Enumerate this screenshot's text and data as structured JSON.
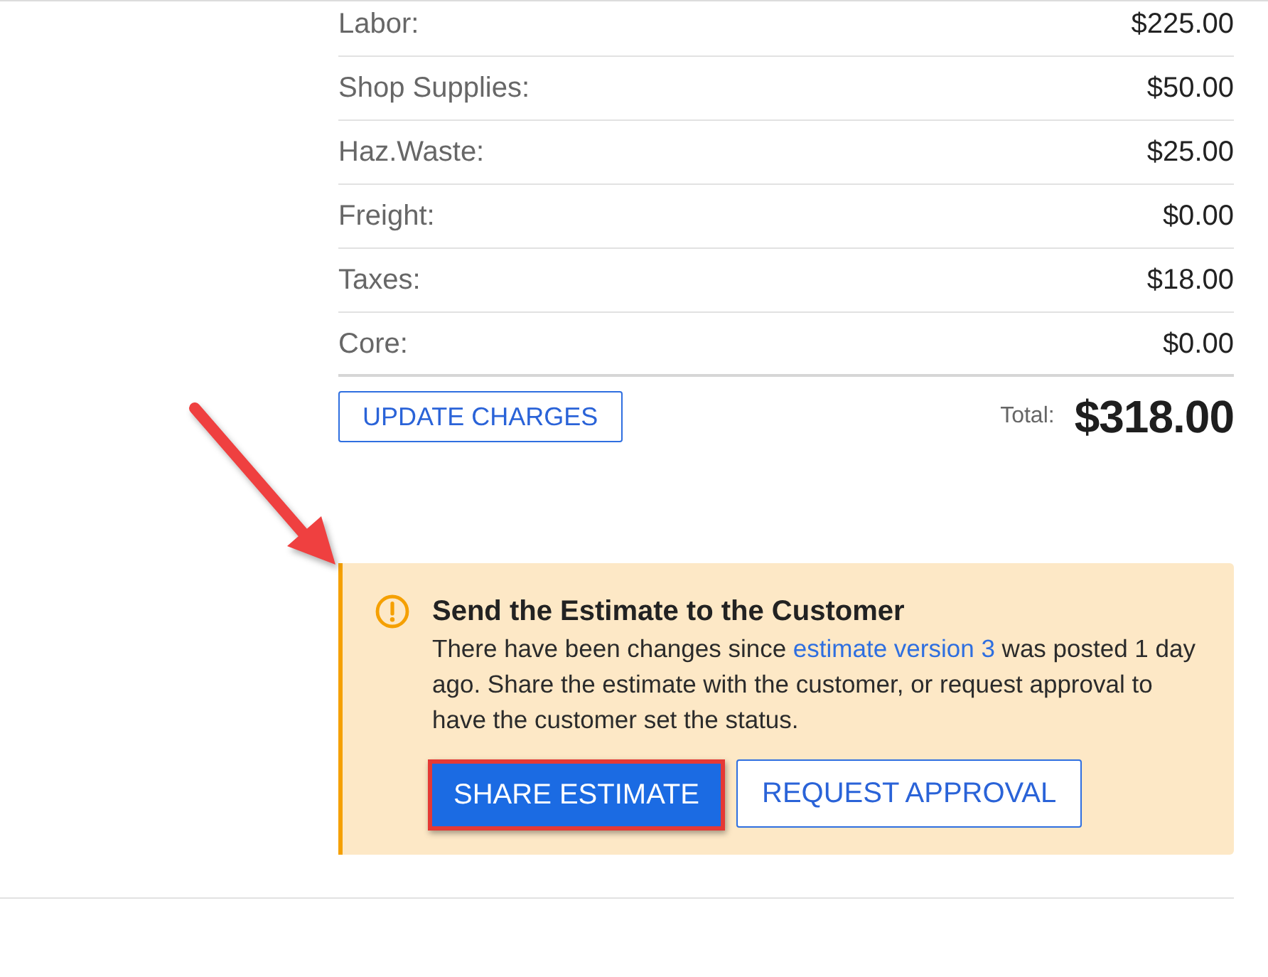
{
  "charges": [
    {
      "label": "Labor:",
      "amount": "$225.00"
    },
    {
      "label": "Shop Supplies:",
      "amount": "$50.00"
    },
    {
      "label": "Haz.Waste:",
      "amount": "$25.00"
    },
    {
      "label": "Freight:",
      "amount": "$0.00"
    },
    {
      "label": "Taxes:",
      "amount": "$18.00"
    },
    {
      "label": "Core:",
      "amount": "$0.00"
    }
  ],
  "update_button": {
    "label": "UPDATE CHARGES"
  },
  "total": {
    "label": "Total:",
    "amount": "$318.00"
  },
  "alert": {
    "title": "Send the Estimate to the Customer",
    "text_before": "There have been changes since ",
    "link": "estimate version 3",
    "text_after": " was posted 1 day ago. Share the estimate with the customer, or request approval to have the customer set the status.",
    "buttons": [
      {
        "label": "SHARE ESTIMATE",
        "kind": "primary",
        "highlighted": true
      },
      {
        "label": "REQUEST APPROVAL",
        "kind": "outline",
        "highlighted": false
      }
    ]
  }
}
